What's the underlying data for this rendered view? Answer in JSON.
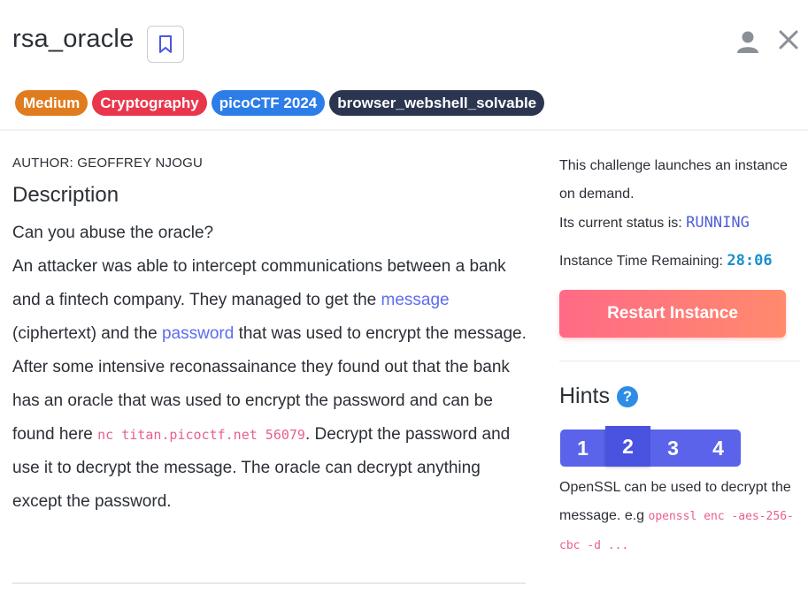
{
  "challenge": {
    "title": "rsa_oracle",
    "tags": [
      {
        "label": "Medium",
        "color": "#e07c1f"
      },
      {
        "label": "Cryptography",
        "color": "#e9364d"
      },
      {
        "label": "picoCTF 2024",
        "color": "#2d7de8"
      },
      {
        "label": "browser_webshell_solvable",
        "color": "#2c3550"
      }
    ]
  },
  "description": {
    "author": "AUTHOR: GEOFFREY NJOGU",
    "heading": "Description",
    "line1": "Can you abuse the oracle?",
    "p2_start": "An attacker was able to intercept communications between a bank and a fintech company. They managed to get the ",
    "link_message": "message",
    "p2_mid": " (ciphertext) and the ",
    "link_password": "password",
    "p2_end": " that was used to encrypt the message.",
    "p3_start": "After some intensive reconassainance they found out that the bank has an oracle that was used to encrypt the password and can be found here ",
    "p3_code": "nc titan.picoctf.net 56079",
    "p3_end": ". Decrypt the password and use it to decrypt the message. The oracle can decrypt anything except the password."
  },
  "instance": {
    "launch_text": "This challenge launches an instance on demand.",
    "status_label": "Its current status is: ",
    "status_value": "RUNNING",
    "time_label": "Instance Time Remaining: ",
    "time_value": "28:06",
    "restart_label": "Restart Instance"
  },
  "hints": {
    "heading": "Hints",
    "help_glyph": "?",
    "tabs": [
      "1",
      "2",
      "3",
      "4"
    ],
    "active_tab": "2",
    "text": "OpenSSL can be used to decrypt the message. e.g ",
    "code": "openssl enc -aes-256-cbc -d ..."
  },
  "icons": {
    "bookmark": "bookmark-icon",
    "user": "user-icon",
    "close": "close-icon"
  }
}
